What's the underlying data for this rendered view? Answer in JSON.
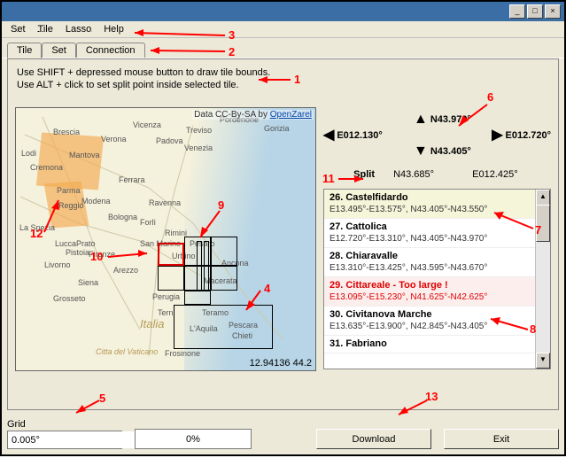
{
  "titlebar": {
    "min": "_",
    "max": "□",
    "close": "×"
  },
  "menu": {
    "set": "Set",
    "tile": "Tile",
    "lasso": "Lasso",
    "help": "Help"
  },
  "tabs": {
    "tile": "Tile",
    "set": "Set",
    "connection": "Connection"
  },
  "hints": {
    "line1": "Use SHIFT + depressed mouse button to draw tile bounds.",
    "line2": "Use ALT + click to set split point inside selected tile."
  },
  "map": {
    "attribution_prefix": "Data CC-By-SA by ",
    "attribution_link": "OpenZarel",
    "mouse_coords": "12.94136 44.2",
    "cities": {
      "brescia": "Brescia",
      "vicenza": "Vicenza",
      "treviso": "Treviso",
      "verona": "Verona",
      "venezia": "Venezia",
      "lodi": "Lodi",
      "mantova": "Mantova",
      "padova": "Padova",
      "pordenone": "Pordenone",
      "cremona": "Cremona",
      "parma": "Parma",
      "ferrara": "Ferrara",
      "reggio": "Reggio",
      "modena": "Modena",
      "ravenna": "Ravenna",
      "bologna": "Bologna",
      "forli": "Forlì",
      "rimini": "Rimini",
      "laspezia": "La Spezia",
      "lucca": "Lucca",
      "prato": "Prato",
      "pistoia": "Pistoia",
      "firenze": "Firenze",
      "pesaro": "Pesaro",
      "livorno": "Livorno",
      "arezzo": "Arezzo",
      "sanmarino": "San Marino",
      "italia": "Italia",
      "ancona": "Ancona",
      "urbino": "Urbino",
      "siena": "Siena",
      "macerata": "Macerata",
      "perugia": "Perugia",
      "terni": "Terni",
      "teramo": "Teramo",
      "aquila": "L'Aquila",
      "pescara": "Pescara",
      "chieti": "Chieti",
      "frosinone": "Frosinone",
      "vaticano": "Citta del Vaticano",
      "gorizia": "Gorizia",
      "grosseto": "Grosseto"
    }
  },
  "nav": {
    "w": "E012.130°",
    "e": "E012.720°",
    "n": "N43.970°",
    "s": "N43.405°"
  },
  "split": {
    "label": "Split",
    "lat": "N43.685°",
    "lon": "E012.425°"
  },
  "list": [
    {
      "title": "26. Castelfidardo",
      "coords": "E13.495°-E13.575°, N43.405°-N43.550°",
      "sel": true,
      "err": false
    },
    {
      "title": "27. Cattolica",
      "coords": "E12.720°-E13.310°, N43.405°-N43.970°",
      "sel": false,
      "err": false
    },
    {
      "title": "28. Chiaravalle",
      "coords": "E13.310°-E13.425°, N43.595°-N43.670°",
      "sel": false,
      "err": false
    },
    {
      "title": "29. Cittareale - Too large !",
      "coords": "E13.095°-E15.230°, N41.625°-N42.625°",
      "sel": false,
      "err": true
    },
    {
      "title": "30. Civitanova Marche",
      "coords": "E13.635°-E13.900°, N42.845°-N43.405°",
      "sel": false,
      "err": false
    },
    {
      "title": "31. Fabriano",
      "coords": "",
      "sel": false,
      "err": false
    }
  ],
  "bottom": {
    "grid_label": "Grid",
    "grid_value": "0.005°",
    "progress": "0%",
    "download": "Download",
    "exit": "Exit"
  },
  "annotations": {
    "n1": "1",
    "n2": "2",
    "n3": "3",
    "n4": "4",
    "n5": "5",
    "n6": "6",
    "n7": "7",
    "n8": "8",
    "n9": "9",
    "n10": "10",
    "n11": "11",
    "n12": "12",
    "n13": "13"
  }
}
